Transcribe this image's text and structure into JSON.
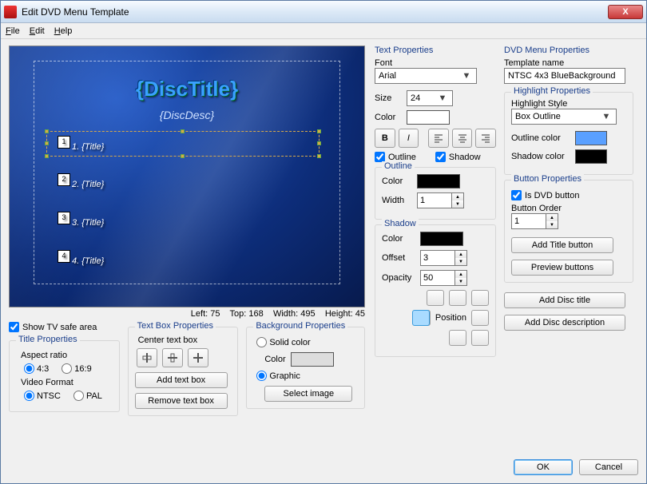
{
  "window": {
    "title": "Edit DVD Menu Template",
    "close": "X"
  },
  "menubar": {
    "file": "File",
    "edit": "Edit",
    "help": "Help"
  },
  "preview": {
    "disc_title": "{DiscTitle}",
    "disc_desc": "{DiscDesc}",
    "items": [
      "1. {Title}",
      "2. {Title}",
      "3. {Title}",
      "4. {Title}"
    ]
  },
  "coords": {
    "left_label": "Left:",
    "left": "75",
    "top_label": "Top:",
    "top": "168",
    "width_label": "Width:",
    "width": "495",
    "height_label": "Height:",
    "height": "45"
  },
  "left_panel": {
    "show_tv": "Show TV safe area",
    "title_props": "Title Properties",
    "aspect_ratio": "Aspect ratio",
    "ar_43": "4:3",
    "ar_169": "16:9",
    "video_format": "Video Format",
    "ntsc": "NTSC",
    "pal": "PAL"
  },
  "textbox": {
    "legend": "Text Box Properties",
    "center": "Center text box",
    "add": "Add text box",
    "remove": "Remove text box"
  },
  "bgprops": {
    "legend": "Background Properties",
    "solid": "Solid color",
    "color": "Color",
    "graphic": "Graphic",
    "select": "Select image"
  },
  "textprops": {
    "legend": "Text Properties",
    "font": "Font",
    "font_val": "Arial",
    "size": "Size",
    "size_val": "24",
    "color": "Color",
    "outline_chk": "Outline",
    "shadow_chk": "Shadow",
    "outline_grp": "Outline",
    "outline_color": "Color",
    "outline_width": "Width",
    "outline_width_val": "1",
    "shadow_grp": "Shadow",
    "shadow_color": "Color",
    "shadow_offset": "Offset",
    "shadow_offset_val": "3",
    "shadow_opacity": "Opacity",
    "shadow_opacity_val": "50",
    "position": "Position"
  },
  "dvdprops": {
    "legend": "DVD Menu Properties",
    "template_name": "Template name",
    "template_val": "NTSC 4x3 BlueBackground",
    "highlight_grp": "Highlight Properties",
    "highlight_style": "Highlight Style",
    "highlight_style_val": "Box Outline",
    "outline_color": "Outline color",
    "outline_color_val": "#5aa0ff",
    "shadow_color": "Shadow color",
    "button_grp": "Button Properties",
    "is_dvd_btn": "Is DVD button",
    "button_order": "Button Order",
    "button_order_val": "1",
    "add_title_btn": "Add Title button",
    "preview_btns": "Preview buttons",
    "add_disc_title": "Add Disc title",
    "add_disc_desc": "Add Disc description"
  },
  "footer": {
    "ok": "OK",
    "cancel": "Cancel"
  }
}
